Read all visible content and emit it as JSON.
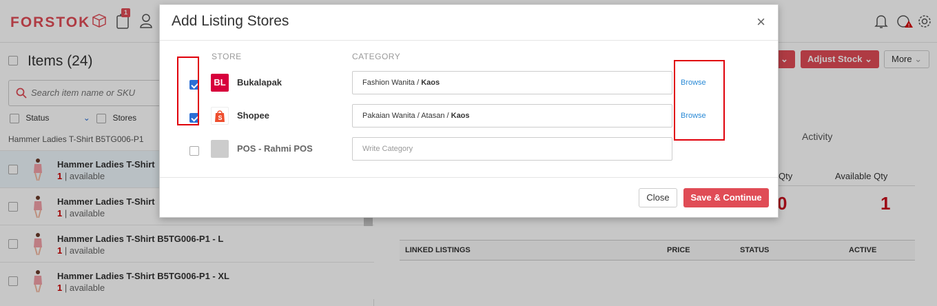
{
  "app": {
    "logo": "FORSTOK",
    "notification_badge": "1"
  },
  "items_panel": {
    "title": "Items",
    "count": "(24)",
    "search_placeholder": "Search item name or SKU",
    "filters": {
      "status": "Status",
      "stores": "Stores"
    },
    "group_label": "Hammer Ladies T-Shirt B5TG006-P1",
    "rows": [
      {
        "name": "Hammer Ladies T-Shirt",
        "qty": "1",
        "avail": " | available"
      },
      {
        "name": "Hammer Ladies T-Shirt",
        "qty": "1",
        "avail": " | available"
      },
      {
        "name": "Hammer Ladies T-Shirt B5TG006-P1 - L",
        "qty": "1",
        "avail": " | available"
      },
      {
        "name": "Hammer Ladies T-Shirt B5TG006-P1 - XL",
        "qty": "1",
        "avail": " | available"
      }
    ]
  },
  "detail_panel": {
    "adjust_stock": "Adjust Stock",
    "more": "More",
    "tab_activity": "Activity",
    "qty_label": "Qty",
    "available_qty_label": "Available Qty",
    "qty_value": "0",
    "available_qty_value": "1",
    "listing_headers": {
      "linked_listings": "LINKED LISTINGS",
      "price": "PRICE",
      "status": "STATUS",
      "active": "ACTIVE"
    }
  },
  "modal": {
    "title": "Add Listing Stores",
    "close_glyph": "×",
    "col_store": "STORE",
    "col_category": "CATEGORY",
    "stores": [
      {
        "name": "Bukalapak",
        "logo_text": "BL",
        "checked": true,
        "category_path": "Fashion Wanita / ",
        "category_leaf": "Kaos",
        "browse": "Browse"
      },
      {
        "name": "Shopee",
        "logo_text": "S",
        "checked": true,
        "category_path": "Pakaian Wanita / Atasan / ",
        "category_leaf": "Kaos",
        "browse": "Browse"
      },
      {
        "name": "POS - Rahmi POS",
        "logo_text": "",
        "checked": false,
        "category_placeholder": "Write Category"
      }
    ],
    "close_button": "Close",
    "save_button": "Save & Continue"
  },
  "colors": {
    "brand": "#e04c56",
    "bukalapak": "#d7003c",
    "shopee": "#ee4d2d",
    "link": "#2a8ad6",
    "annotation": "#e0000a"
  }
}
